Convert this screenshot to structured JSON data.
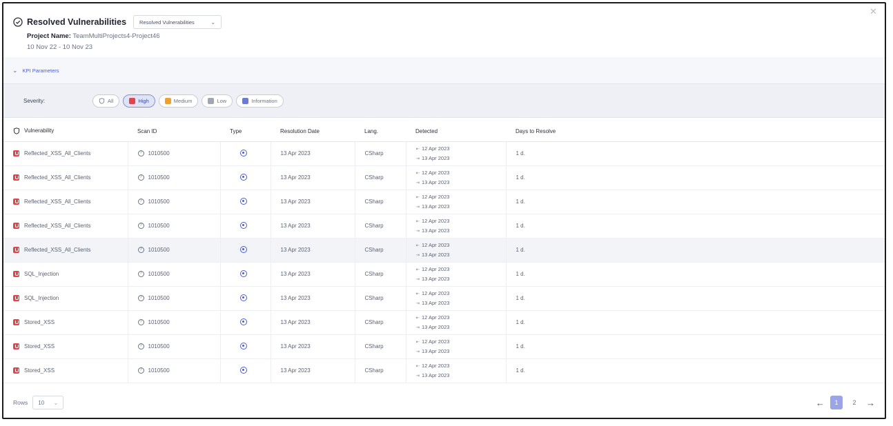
{
  "header": {
    "title": "Resolved Vulnerabilities",
    "select_value": "Resolved Vulnerabilities",
    "project_label": "Project Name:",
    "project_name": "TeamMultiProjects4-Project46",
    "date_range": "10 Nov 22 - 10 Nov 23"
  },
  "kpi": {
    "label": "KPI Parameters"
  },
  "severity": {
    "label": "Severity:",
    "chips": [
      {
        "label": "All",
        "active": false,
        "color": "#ffffff"
      },
      {
        "label": "High",
        "active": true,
        "color": "#e0454b"
      },
      {
        "label": "Medium",
        "active": false,
        "color": "#f0a030"
      },
      {
        "label": "Low",
        "active": false,
        "color": "#a0a6b4"
      },
      {
        "label": "Information",
        "active": false,
        "color": "#6b7ad6"
      }
    ]
  },
  "table": {
    "headers": [
      "Vulnerability",
      "Scan ID",
      "Type",
      "Resolution Date",
      "Lang.",
      "Detected",
      "Days to Resolve"
    ],
    "rows": [
      {
        "name": "Reflected_XSS_All_Clients",
        "scan": "1010500",
        "date": "13 Apr 2023",
        "lang": "CSharp",
        "det_from": "12 Apr 2023",
        "det_to": "13 Apr 2023",
        "days": "1 d."
      },
      {
        "name": "Reflected_XSS_All_Clients",
        "scan": "1010500",
        "date": "13 Apr 2023",
        "lang": "CSharp",
        "det_from": "12 Apr 2023",
        "det_to": "13 Apr 2023",
        "days": "1 d."
      },
      {
        "name": "Reflected_XSS_All_Clients",
        "scan": "1010500",
        "date": "13 Apr 2023",
        "lang": "CSharp",
        "det_from": "12 Apr 2023",
        "det_to": "13 Apr 2023",
        "days": "1 d."
      },
      {
        "name": "Reflected_XSS_All_Clients",
        "scan": "1010500",
        "date": "13 Apr 2023",
        "lang": "CSharp",
        "det_from": "12 Apr 2023",
        "det_to": "13 Apr 2023",
        "days": "1 d."
      },
      {
        "name": "Reflected_XSS_All_Clients",
        "scan": "1010500",
        "date": "13 Apr 2023",
        "lang": "CSharp",
        "det_from": "12 Apr 2023",
        "det_to": "13 Apr 2023",
        "days": "1 d.",
        "highlight": true
      },
      {
        "name": "SQL_Injection",
        "scan": "1010500",
        "date": "13 Apr 2023",
        "lang": "CSharp",
        "det_from": "12 Apr 2023",
        "det_to": "13 Apr 2023",
        "days": "1 d."
      },
      {
        "name": "SQL_Injection",
        "scan": "1010500",
        "date": "13 Apr 2023",
        "lang": "CSharp",
        "det_from": "12 Apr 2023",
        "det_to": "13 Apr 2023",
        "days": "1 d."
      },
      {
        "name": "Stored_XSS",
        "scan": "1010500",
        "date": "13 Apr 2023",
        "lang": "CSharp",
        "det_from": "12 Apr 2023",
        "det_to": "13 Apr 2023",
        "days": "1 d."
      },
      {
        "name": "Stored_XSS",
        "scan": "1010500",
        "date": "13 Apr 2023",
        "lang": "CSharp",
        "det_from": "12 Apr 2023",
        "det_to": "13 Apr 2023",
        "days": "1 d."
      },
      {
        "name": "Stored_XSS",
        "scan": "1010500",
        "date": "13 Apr 2023",
        "lang": "CSharp",
        "det_from": "12 Apr 2023",
        "det_to": "13 Apr 2023",
        "days": "1 d."
      }
    ]
  },
  "footer": {
    "rows_label": "Rows",
    "rows_value": "10",
    "pages": [
      "1",
      "2"
    ],
    "current_page": "1"
  }
}
